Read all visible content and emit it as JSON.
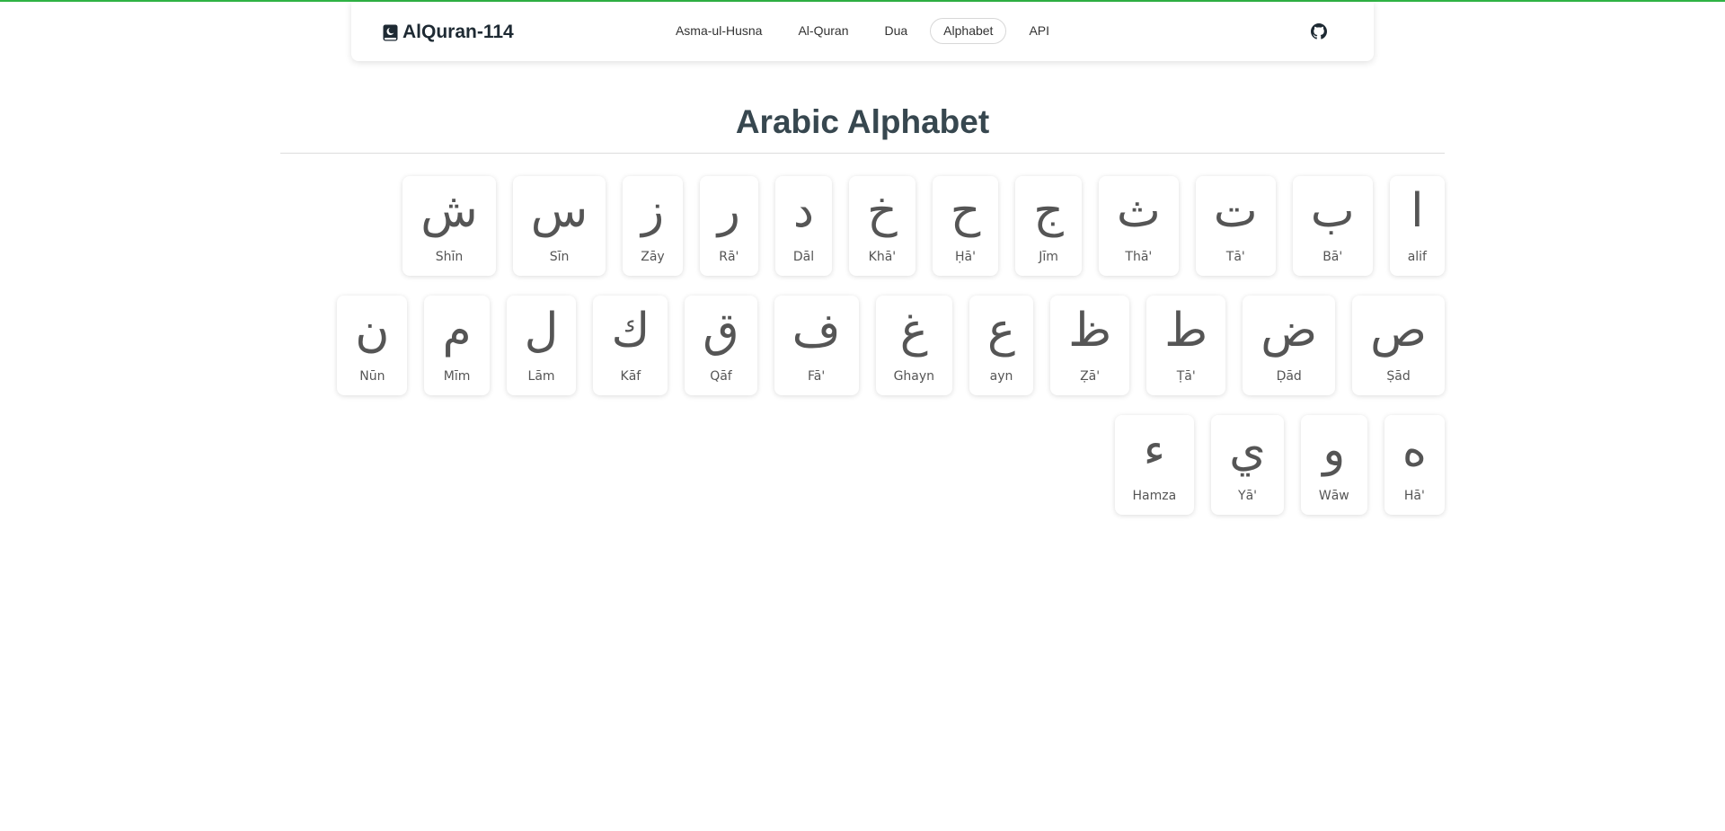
{
  "colors": {
    "accent": "#2fb344",
    "title": "#37474f",
    "letter": "#555555"
  },
  "brand": {
    "icon": "book-moon-icon",
    "name": "AlQuran-114"
  },
  "nav": [
    {
      "label": "Asma-ul-Husna",
      "active": false
    },
    {
      "label": "Al-Quran",
      "active": false
    },
    {
      "label": "Dua",
      "active": false
    },
    {
      "label": "Alphabet",
      "active": true
    },
    {
      "label": "API",
      "active": false
    }
  ],
  "github": {
    "icon": "github-icon"
  },
  "page": {
    "title": "Arabic Alphabet"
  },
  "letters": [
    {
      "arabic": "ا",
      "name": "alif"
    },
    {
      "arabic": "ب",
      "name": "Bā'"
    },
    {
      "arabic": "ت",
      "name": "Tā'"
    },
    {
      "arabic": "ث",
      "name": "Thā'"
    },
    {
      "arabic": "ج",
      "name": "Jīm"
    },
    {
      "arabic": "ح",
      "name": "Ḥā'"
    },
    {
      "arabic": "خ",
      "name": "Khā'"
    },
    {
      "arabic": "د",
      "name": "Dāl"
    },
    {
      "arabic": "ر",
      "name": "Rā'"
    },
    {
      "arabic": "ز",
      "name": "Zāy"
    },
    {
      "arabic": "س",
      "name": "Sīn"
    },
    {
      "arabic": "ش",
      "name": "Shīn"
    },
    {
      "arabic": "ص",
      "name": "Ṣād"
    },
    {
      "arabic": "ض",
      "name": "Ḍād"
    },
    {
      "arabic": "ط",
      "name": "Ṭā'"
    },
    {
      "arabic": "ظ",
      "name": "Ẓā'"
    },
    {
      "arabic": "ع",
      "name": "ayn"
    },
    {
      "arabic": "غ",
      "name": "Ghayn"
    },
    {
      "arabic": "ف",
      "name": "Fā'"
    },
    {
      "arabic": "ق",
      "name": "Qāf"
    },
    {
      "arabic": "ك",
      "name": "Kāf"
    },
    {
      "arabic": "ل",
      "name": "Lām"
    },
    {
      "arabic": "م",
      "name": "Mīm"
    },
    {
      "arabic": "ن",
      "name": "Nūn"
    },
    {
      "arabic": "ه",
      "name": "Hā'"
    },
    {
      "arabic": "و",
      "name": "Wāw"
    },
    {
      "arabic": "ي",
      "name": "Yā'"
    },
    {
      "arabic": "ء",
      "name": "Hamza"
    }
  ]
}
